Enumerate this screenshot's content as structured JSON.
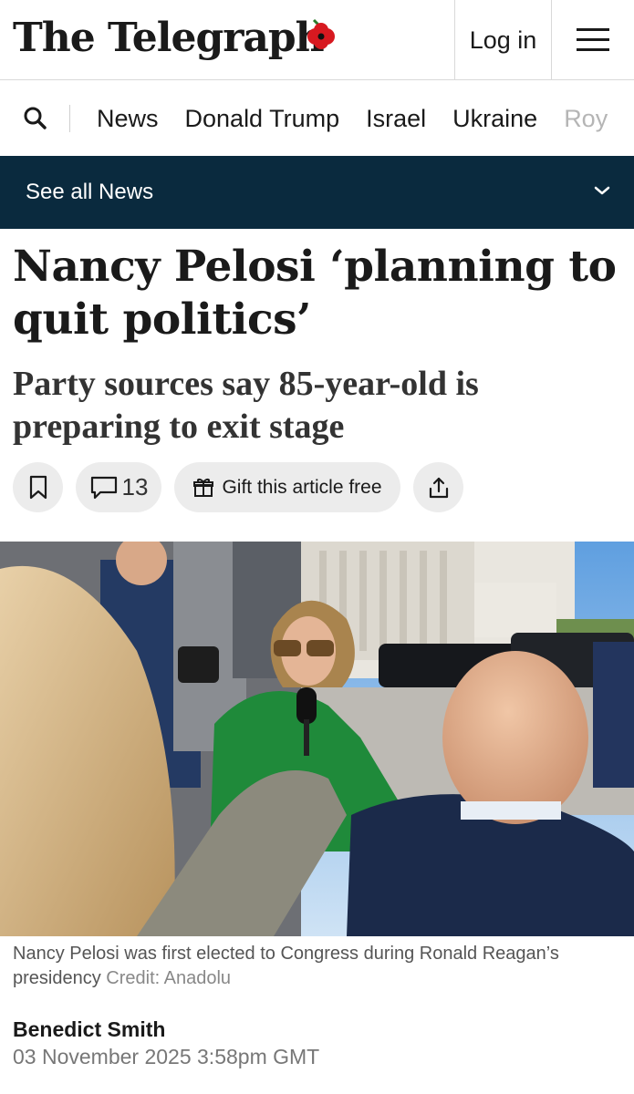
{
  "header": {
    "logo_text": "The Telegraph",
    "login_label": "Log in",
    "menu_icon": "hamburger-icon"
  },
  "nav": {
    "search_icon": "search-icon",
    "items": [
      "News",
      "Donald Trump",
      "Israel",
      "Ukraine",
      "Roy"
    ]
  },
  "section_bar": {
    "label": "See all News",
    "icon": "chevron-down-icon"
  },
  "article": {
    "headline": "Nancy Pelosi ‘planning to quit politics’",
    "standfirst": "Party sources say 85-year-old is preparing to exit stage",
    "actions": {
      "bookmark_icon": "bookmark-icon",
      "comment_icon": "comment-icon",
      "comment_count": "13",
      "gift_icon": "gift-icon",
      "gift_label": "Gift this article free",
      "share_icon": "share-icon"
    },
    "image": {
      "caption": "Nancy Pelosi was first elected to Congress during Ronald Reagan’s presidency",
      "credit": "Credit: Anadolu"
    },
    "author": "Benedict Smith",
    "date": "03 November 2025 3:58pm GMT"
  },
  "colors": {
    "section_bar_bg": "#0a2a3e",
    "poppy_red": "#d71920",
    "pill_bg": "#ececec"
  }
}
